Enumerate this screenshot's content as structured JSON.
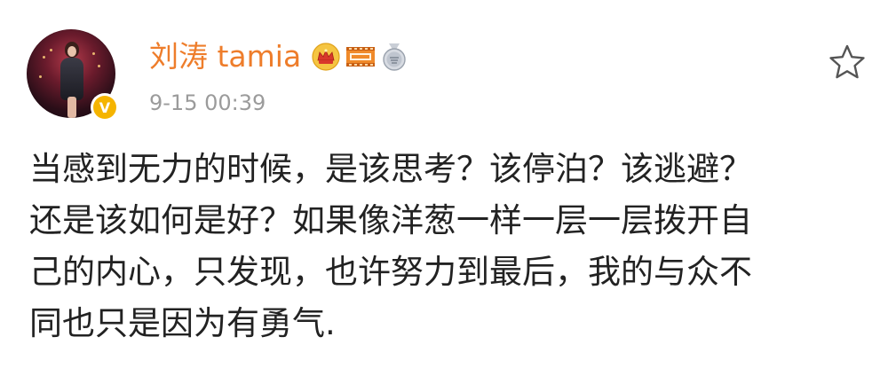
{
  "post": {
    "author": {
      "name": "刘涛 tamia",
      "avatar_icon": "avatar-photo",
      "verified_icon": "verified-v-icon",
      "verified_glyph": "V",
      "badges": [
        "crown-icon",
        "movie-icon",
        "medal-icon"
      ]
    },
    "timestamp": "9-15 00:39",
    "favorite_icon": "star-icon",
    "content_lines": [
      "当感到无力的时候，是该思考？该停泊？该逃避？",
      "还是该如何是好？如果像洋葱一样一层一层拨开自",
      "己的内心，只发现，也许努力到最后，我的与众不",
      "同也只是因为有勇气."
    ]
  },
  "colors": {
    "username": "#ee7d2b",
    "timestamp": "#9b9b9b",
    "body_text": "#222222",
    "verified_badge": "#f5b400"
  }
}
